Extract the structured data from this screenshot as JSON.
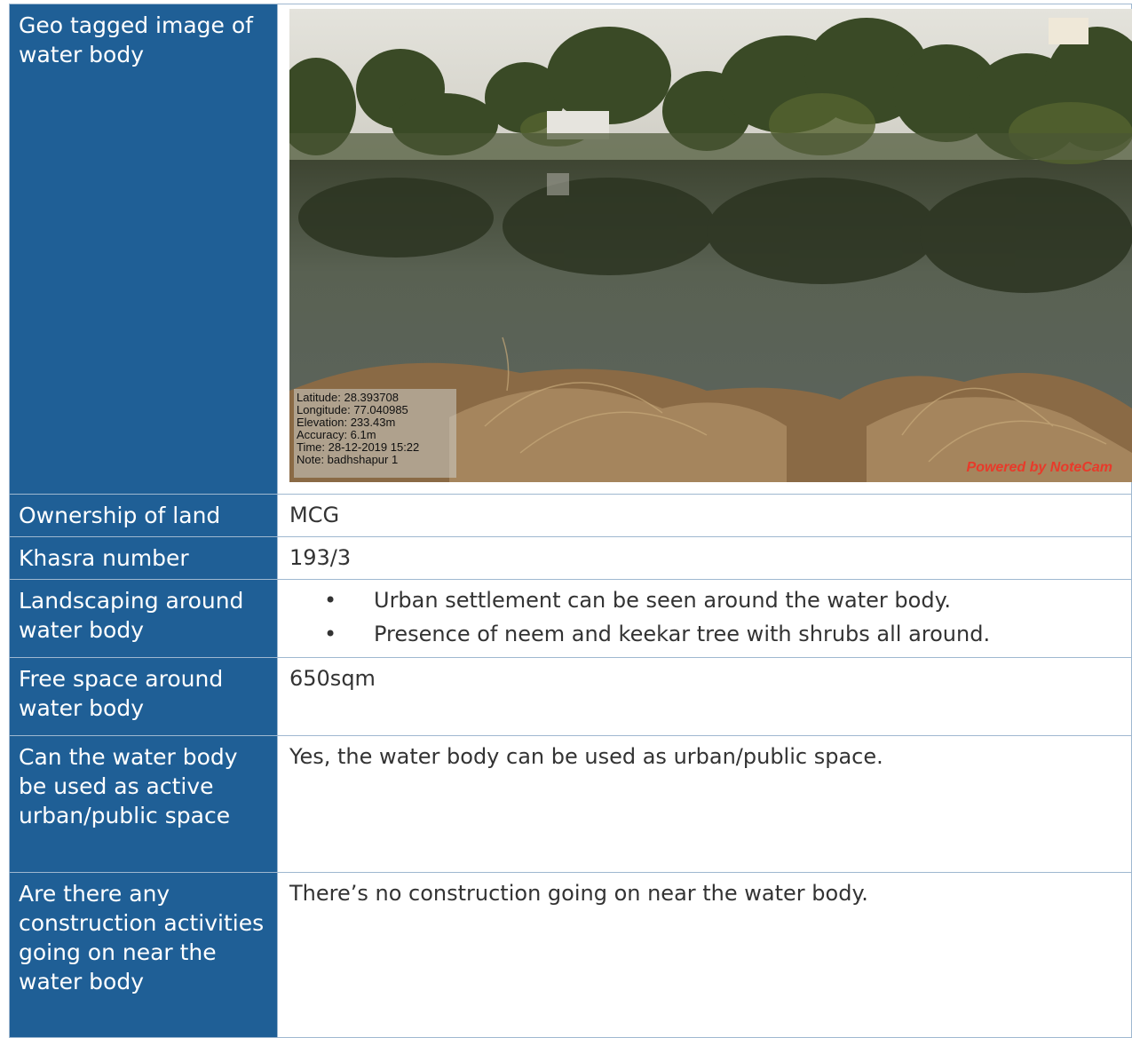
{
  "rows": {
    "photo": {
      "label": "Geo tagged image of water body"
    },
    "ownership": {
      "label": "Ownership of land",
      "value": "MCG"
    },
    "khasra": {
      "label": "Khasra number",
      "value": "193/3"
    },
    "landscaping": {
      "label": "Landscaping around water body",
      "items": [
        "Urban settlement can be seen around the water body.",
        "Presence of neem and keekar tree with shrubs all around."
      ]
    },
    "free_space": {
      "label": "Free space around water body",
      "value": "650sqm"
    },
    "urban_use": {
      "label": "Can the water body be used as active urban/public space",
      "value": "Yes, the water body can be used as urban/public space."
    },
    "construction": {
      "label": "Are there any construction activities going on near the water body",
      "value": "There’s no construction going on near the water body."
    }
  },
  "photo_overlay": {
    "lines": [
      "Latitude: 28.393708",
      "Longitude: 77.040985",
      "Elevation: 233.43m",
      "Accuracy: 6.1m",
      "Time: 28-12-2019 15:22",
      "Note: badhshapur 1"
    ],
    "watermark": "Powered by NoteCam"
  },
  "colors": {
    "label_bg": "#1f5f96",
    "label_text": "#ffffff",
    "border": "#9fb8d0",
    "watermark": "#e83a2a"
  }
}
